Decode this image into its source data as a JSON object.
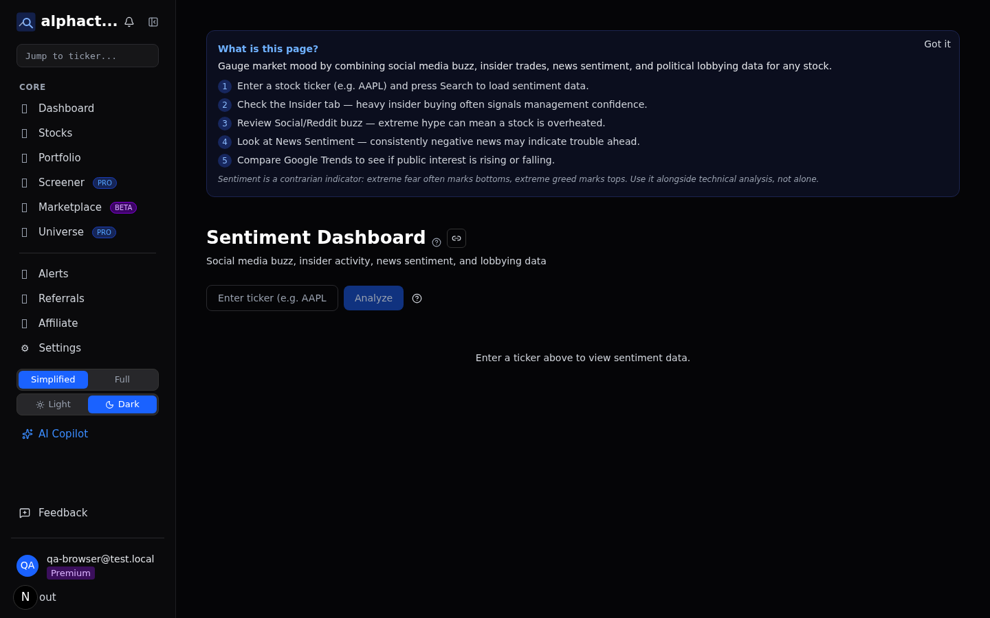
{
  "brand": {
    "name": "alphact..."
  },
  "ticker_search": {
    "placeholder": "Jump to ticker..."
  },
  "nav_section": "CORE",
  "nav_items": [
    {
      "label": "Dashboard",
      "kind": "glyph"
    },
    {
      "label": "Stocks",
      "kind": "glyph"
    },
    {
      "label": "Portfolio",
      "kind": "glyph"
    },
    {
      "label": "Screener",
      "kind": "glyph",
      "badge": {
        "text": "PRO",
        "kind": "pro"
      }
    },
    {
      "label": "Marketplace",
      "kind": "glyph",
      "badge": {
        "text": "BETA",
        "kind": "beta"
      }
    },
    {
      "label": "Universe",
      "kind": "glyph",
      "badge": {
        "text": "PRO",
        "kind": "pro"
      }
    }
  ],
  "nav_items_2": [
    {
      "label": "Alerts",
      "kind": "glyph"
    },
    {
      "label": "Referrals",
      "kind": "glyph"
    },
    {
      "label": "Affiliate",
      "kind": "glyph"
    },
    {
      "label": "Settings",
      "kind": "char",
      "char": "⚙"
    }
  ],
  "mode_toggle": [
    {
      "label": "Simplified",
      "selected": true
    },
    {
      "label": "Full",
      "selected": false
    }
  ],
  "theme_toggle": [
    {
      "label": "Light",
      "kind": "sun",
      "selected": false
    },
    {
      "label": "Dark",
      "kind": "moon",
      "selected": true
    }
  ],
  "copilot": "AI Copilot",
  "feedback": "Feedback",
  "user": {
    "initials": "QA",
    "email": "qa-browser@test.local",
    "plan": "Premium"
  },
  "dev_badge": "N",
  "sign_out": "out",
  "help_card": {
    "title": "What is this page?",
    "dismiss": "Got it",
    "intro": "Gauge market mood by combining social media buzz, insider trades, news sentiment, and political lobbying data for any stock.",
    "steps": [
      {
        "number": "1",
        "text": "Enter a stock ticker (e.g. AAPL) and press Search to load sentiment data."
      },
      {
        "number": "2",
        "text": "Check the Insider tab — heavy insider buying often signals management confidence."
      },
      {
        "number": "3",
        "text": "Review Social/Reddit buzz — extreme hype can mean a stock is overheated."
      },
      {
        "number": "4",
        "text": "Look at News Sentiment — consistently negative news may indicate trouble ahead."
      },
      {
        "number": "5",
        "text": "Compare Google Trends to see if public interest is rising or falling."
      }
    ],
    "note": "Sentiment is a contrarian indicator: extreme fear often marks bottoms, extreme greed marks tops. Use it alongside technical analysis, not alone."
  },
  "page": {
    "title": "Sentiment Dashboard",
    "subtitle": "Social media buzz, insider activity, news sentiment, and lobbying data"
  },
  "ticker_input": {
    "placeholder": "Enter ticker (e.g. AAPL"
  },
  "analyze_button": {
    "label": "Analyze",
    "disabled": true
  },
  "empty_state": "Enter a ticker above to view sentiment data."
}
